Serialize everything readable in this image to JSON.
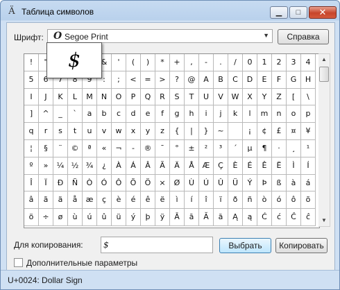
{
  "window": {
    "title": "Таблица символов"
  },
  "controls": {
    "font_label": "Шрифт:",
    "font_value": "Segoe Print",
    "help_button": "Справка",
    "copy_label": "Для копирования:",
    "copy_value": "$",
    "select_button": "Выбрать",
    "copy_button": "Копировать",
    "advanced_label": "Дополнительные параметры"
  },
  "zoomed_char": "$",
  "status_text": "U+0024: Dollar Sign",
  "grid": {
    "rows": [
      [
        "!",
        "\"",
        "#",
        "$",
        "%",
        "&",
        "'",
        "(",
        ")",
        "*",
        "+",
        ",",
        "-",
        ".",
        "/",
        "0",
        "1",
        "2",
        "3",
        "4"
      ],
      [
        "5",
        "6",
        "7",
        "8",
        "9",
        ":",
        ";",
        "<",
        "=",
        ">",
        "?",
        "@",
        "A",
        "B",
        "C",
        "D",
        "E",
        "F",
        "G",
        "H"
      ],
      [
        "I",
        "J",
        "K",
        "L",
        "M",
        "N",
        "O",
        "P",
        "Q",
        "R",
        "S",
        "T",
        "U",
        "V",
        "W",
        "X",
        "Y",
        "Z",
        "[",
        "\\"
      ],
      [
        "]",
        "^",
        "_",
        "`",
        "a",
        "b",
        "c",
        "d",
        "e",
        "f",
        "g",
        "h",
        "i",
        "j",
        "k",
        "l",
        "m",
        "n",
        "o",
        "p"
      ],
      [
        "q",
        "r",
        "s",
        "t",
        "u",
        "v",
        "w",
        "x",
        "y",
        "z",
        "{",
        "|",
        "}",
        "~",
        "",
        "¡",
        "¢",
        "£",
        "¤",
        "¥"
      ],
      [
        "¦",
        "§",
        "¨",
        "©",
        "ª",
        "«",
        "¬",
        "-",
        "®",
        "¯",
        "°",
        "±",
        "²",
        "³",
        "´",
        "µ",
        "¶",
        "·",
        "¸",
        "¹"
      ],
      [
        "º",
        "»",
        "¼",
        "½",
        "¾",
        "¿",
        "À",
        "Á",
        "Â",
        "Ã",
        "Ä",
        "Å",
        "Æ",
        "Ç",
        "È",
        "É",
        "Ê",
        "Ë",
        "Ì",
        "Í"
      ],
      [
        "Î",
        "Ï",
        "Ð",
        "Ñ",
        "Ò",
        "Ó",
        "Ô",
        "Õ",
        "Ö",
        "×",
        "Ø",
        "Ù",
        "Ú",
        "Û",
        "Ü",
        "Ý",
        "Þ",
        "ß",
        "à",
        "á"
      ],
      [
        "â",
        "ã",
        "ä",
        "å",
        "æ",
        "ç",
        "è",
        "é",
        "ê",
        "ë",
        "ì",
        "í",
        "î",
        "ï",
        "ð",
        "ñ",
        "ò",
        "ó",
        "ô",
        "õ"
      ],
      [
        "ö",
        "÷",
        "ø",
        "ù",
        "ú",
        "û",
        "ü",
        "ý",
        "þ",
        "ÿ",
        "Ā",
        "ā",
        "Ă",
        "ă",
        "Ą",
        "ą",
        "Ć",
        "ć",
        "Ĉ",
        "ĉ"
      ]
    ]
  }
}
